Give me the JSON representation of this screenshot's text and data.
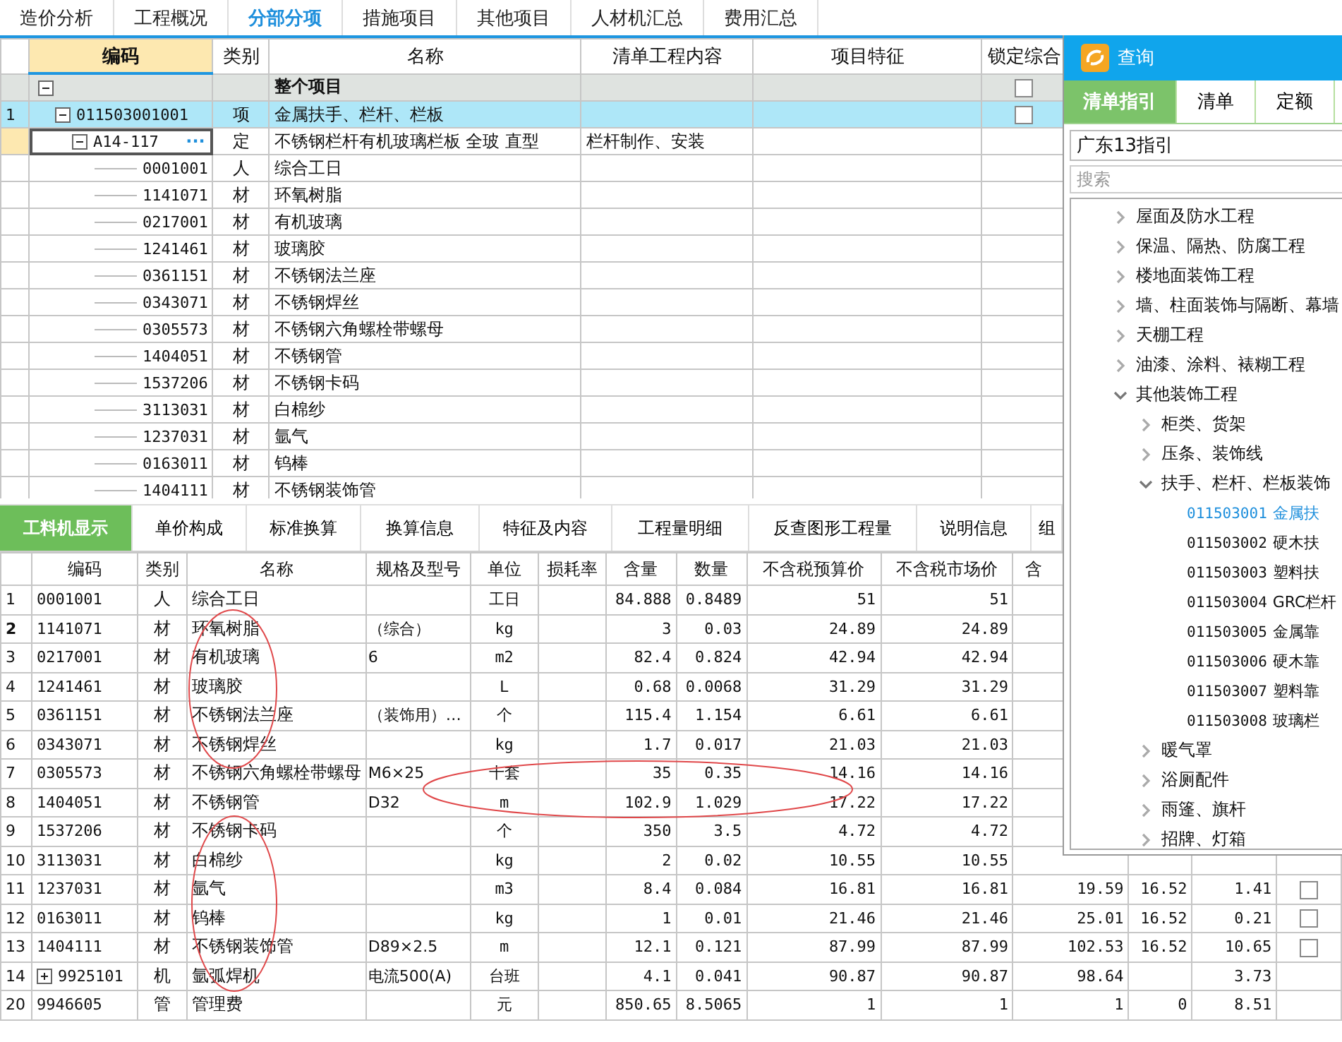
{
  "top_tabs": [
    {
      "label": "造价分析",
      "selected": false
    },
    {
      "label": "工程概况",
      "selected": false
    },
    {
      "label": "分部分项",
      "selected": true
    },
    {
      "label": "措施项目",
      "selected": false
    },
    {
      "label": "其他项目",
      "selected": false
    },
    {
      "label": "人材机汇总",
      "selected": false
    },
    {
      "label": "费用汇总",
      "selected": false
    }
  ],
  "upper_grid": {
    "columns": [
      "编码",
      "类别",
      "名称",
      "清单工程内容",
      "项目特征",
      "锁定综合"
    ],
    "tree": [
      {
        "name": "整个项目",
        "expanded": true,
        "checked": false,
        "selected": false,
        "highlighted": false,
        "children": [
          {
            "row_number": "1",
            "code": "011503001001",
            "type": "项",
            "name": "金属扶手、栏杆、栏板",
            "expanded": true,
            "checked": false,
            "selected": false,
            "highlighted": true,
            "children": [
              {
                "code": "A14-117",
                "more_button": "···",
                "type": "定",
                "name": "不锈钢栏杆有机玻璃栏板 全玻 直型",
                "content": "栏杆制作、安装",
                "expanded": true,
                "selected": true,
                "highlighted": false,
                "children": [
                  {
                    "code": "0001001",
                    "type": "人",
                    "name": "综合工日",
                    "selected": false,
                    "highlighted": false
                  },
                  {
                    "code": "1141071",
                    "type": "材",
                    "name": "环氧树脂",
                    "selected": false,
                    "highlighted": false
                  },
                  {
                    "code": "0217001",
                    "type": "材",
                    "name": "有机玻璃",
                    "selected": false,
                    "highlighted": false
                  },
                  {
                    "code": "1241461",
                    "type": "材",
                    "name": "玻璃胶",
                    "selected": false,
                    "highlighted": false
                  },
                  {
                    "code": "0361151",
                    "type": "材",
                    "name": "不锈钢法兰座",
                    "selected": false,
                    "highlighted": false
                  },
                  {
                    "code": "0343071",
                    "type": "材",
                    "name": "不锈钢焊丝",
                    "selected": false,
                    "highlighted": false
                  },
                  {
                    "code": "0305573",
                    "type": "材",
                    "name": "不锈钢六角螺栓带螺母",
                    "selected": false,
                    "highlighted": false
                  },
                  {
                    "code": "1404051",
                    "type": "材",
                    "name": "不锈钢管",
                    "selected": false,
                    "highlighted": false
                  },
                  {
                    "code": "1537206",
                    "type": "材",
                    "name": "不锈钢卡码",
                    "selected": false,
                    "highlighted": false
                  },
                  {
                    "code": "3113031",
                    "type": "材",
                    "name": "白棉纱",
                    "selected": false,
                    "highlighted": false
                  },
                  {
                    "code": "1237031",
                    "type": "材",
                    "name": "氩气",
                    "selected": false,
                    "highlighted": false
                  },
                  {
                    "code": "0163011",
                    "type": "材",
                    "name": "钨棒",
                    "selected": false,
                    "highlighted": false
                  },
                  {
                    "code": "1404111",
                    "type": "材",
                    "name": "不锈钢装饰管",
                    "selected": false,
                    "highlighted": false
                  }
                ]
              }
            ]
          }
        ]
      }
    ]
  },
  "lower_tabs": [
    {
      "label": "工料机显示",
      "selected": true
    },
    {
      "label": "单价构成",
      "selected": false
    },
    {
      "label": "标准换算",
      "selected": false
    },
    {
      "label": "换算信息",
      "selected": false
    },
    {
      "label": "特征及内容",
      "selected": false
    },
    {
      "label": "工程量明细",
      "selected": false
    },
    {
      "label": "反查图形工程量",
      "selected": false
    },
    {
      "label": "说明信息",
      "selected": false
    },
    {
      "label": "组",
      "selected": false
    }
  ],
  "lower_grid": {
    "columns": [
      "编码",
      "类别",
      "名称",
      "规格及型号",
      "单位",
      "损耗率",
      "含量",
      "数量",
      "不含税预算价",
      "不含税市场价",
      "含"
    ],
    "rows": [
      {
        "row_number": "1",
        "code": "0001001",
        "type": "人",
        "name": "综合工日",
        "unit": "工日",
        "amount": "84.888",
        "quantity": "0.8489",
        "budget_price": "51",
        "market_price": "51",
        "selected": false,
        "expandable": false
      },
      {
        "row_number": "2",
        "code": "1141071",
        "type": "材",
        "name": "环氧树脂",
        "spec": "（综合）",
        "unit": "kg",
        "amount": "3",
        "quantity": "0.03",
        "budget_price": "24.89",
        "market_price": "24.89",
        "selected": true,
        "expandable": false
      },
      {
        "row_number": "3",
        "code": "0217001",
        "type": "材",
        "name": "有机玻璃",
        "spec": "6",
        "unit": "m2",
        "amount": "82.4",
        "quantity": "0.824",
        "budget_price": "42.94",
        "market_price": "42.94",
        "selected": false,
        "expandable": false
      },
      {
        "row_number": "4",
        "code": "1241461",
        "type": "材",
        "name": "玻璃胶",
        "unit": "L",
        "amount": "0.68",
        "quantity": "0.0068",
        "budget_price": "31.29",
        "market_price": "31.29",
        "selected": false,
        "expandable": false
      },
      {
        "row_number": "5",
        "code": "0361151",
        "type": "材",
        "name": "不锈钢法兰座",
        "spec": "（装饰用）…",
        "unit": "个",
        "amount": "115.4",
        "quantity": "1.154",
        "budget_price": "6.61",
        "market_price": "6.61",
        "selected": false,
        "expandable": false
      },
      {
        "row_number": "6",
        "code": "0343071",
        "type": "材",
        "name": "不锈钢焊丝",
        "unit": "kg",
        "amount": "1.7",
        "quantity": "0.017",
        "budget_price": "21.03",
        "market_price": "21.03",
        "selected": false,
        "expandable": false
      },
      {
        "row_number": "7",
        "code": "0305573",
        "type": "材",
        "name": "不锈钢六角螺栓带螺母",
        "spec": "M6×25",
        "unit": "十套",
        "amount": "35",
        "quantity": "0.35",
        "budget_price": "14.16",
        "market_price": "14.16",
        "selected": false,
        "expandable": false
      },
      {
        "row_number": "8",
        "code": "1404051",
        "type": "材",
        "name": "不锈钢管",
        "spec": "D32",
        "unit": "m",
        "amount": "102.9",
        "quantity": "1.029",
        "budget_price": "17.22",
        "market_price": "17.22",
        "selected": false,
        "expandable": false
      },
      {
        "row_number": "9",
        "code": "1537206",
        "type": "材",
        "name": "不锈钢卡码",
        "unit": "个",
        "amount": "350",
        "quantity": "3.5",
        "budget_price": "4.72",
        "market_price": "4.72",
        "selected": false,
        "expandable": false
      },
      {
        "row_number": "10",
        "code": "3113031",
        "type": "材",
        "name": "白棉纱",
        "unit": "kg",
        "amount": "2",
        "quantity": "0.02",
        "budget_price": "10.55",
        "market_price": "10.55",
        "selected": false,
        "expandable": false
      },
      {
        "row_number": "11",
        "code": "1237031",
        "type": "材",
        "name": "氩气",
        "unit": "m3",
        "amount": "8.4",
        "quantity": "0.084",
        "budget_price": "16.81",
        "market_price": "16.81",
        "column_11": "19.59",
        "column_12": "16.52",
        "column_13": "1.41",
        "selected": false,
        "expandable": false,
        "checked": false
      },
      {
        "row_number": "12",
        "code": "0163011",
        "type": "材",
        "name": "钨棒",
        "unit": "kg",
        "amount": "1",
        "quantity": "0.01",
        "budget_price": "21.46",
        "market_price": "21.46",
        "column_11": "25.01",
        "column_12": "16.52",
        "column_13": "0.21",
        "selected": false,
        "expandable": false,
        "checked": false
      },
      {
        "row_number": "13",
        "code": "1404111",
        "type": "材",
        "name": "不锈钢装饰管",
        "spec": "D89×2.5",
        "unit": "m",
        "amount": "12.1",
        "quantity": "0.121",
        "budget_price": "87.99",
        "market_price": "87.99",
        "column_11": "102.53",
        "column_12": "16.52",
        "column_13": "10.65",
        "selected": false,
        "expandable": false,
        "checked": false
      },
      {
        "row_number": "14",
        "code": "9925101",
        "type": "机",
        "name": "氩弧焊机",
        "spec": "电流500(A)",
        "unit": "台班",
        "amount": "4.1",
        "quantity": "0.041",
        "budget_price": "90.87",
        "market_price": "90.87",
        "column_11": "98.64",
        "column_13": "3.73",
        "selected": false,
        "expandable": true
      },
      {
        "row_number": "20",
        "code": "9946605",
        "type": "管",
        "name": "管理费",
        "unit": "元",
        "amount": "850.65",
        "quantity": "8.5065",
        "budget_price": "1",
        "market_price": "1",
        "column_11": "1",
        "column_12": "0",
        "column_13": "8.51",
        "selected": false,
        "expandable": false
      }
    ]
  },
  "query_panel": {
    "title": "查询",
    "tabs": [
      {
        "label": "清单指引",
        "selected": true
      },
      {
        "label": "清单",
        "selected": false
      },
      {
        "label": "定额",
        "selected": false
      }
    ],
    "guide": "广东13指引",
    "search_placeholder": "搜索",
    "tree": [
      {
        "label": "屋面及防水工程",
        "expanded": false
      },
      {
        "label": "保温、隔热、防腐工程",
        "expanded": false
      },
      {
        "label": "楼地面装饰工程",
        "expanded": false
      },
      {
        "label": "墙、柱面装饰与隔断、幕墙",
        "expanded": false
      },
      {
        "label": "天棚工程",
        "expanded": false
      },
      {
        "label": "油漆、涂料、裱糊工程",
        "expanded": false
      },
      {
        "label": "其他装饰工程",
        "expanded": true,
        "children": [
          {
            "label": "柜类、货架",
            "expanded": false
          },
          {
            "label": "压条、装饰线",
            "expanded": false
          },
          {
            "label": "扶手、栏杆、栏板装饰",
            "expanded": true,
            "children": [
              {
                "code": "011503001",
                "name": "金属扶",
                "selected": true
              },
              {
                "code": "011503002",
                "name": "硬木扶",
                "selected": false
              },
              {
                "code": "011503003",
                "name": "塑料扶",
                "selected": false
              },
              {
                "code": "011503004",
                "name": "GRC栏杆",
                "selected": false
              },
              {
                "code": "011503005",
                "name": "金属靠",
                "selected": false
              },
              {
                "code": "011503006",
                "name": "硬木靠",
                "selected": false
              },
              {
                "code": "011503007",
                "name": "塑料靠",
                "selected": false
              },
              {
                "code": "011503008",
                "name": "玻璃栏",
                "selected": false
              }
            ]
          },
          {
            "label": "暖气罩",
            "expanded": false
          },
          {
            "label": "浴厕配件",
            "expanded": false
          },
          {
            "label": "雨篷、旗杆",
            "expanded": false
          },
          {
            "label": "招牌、灯箱",
            "expanded": false
          }
        ]
      }
    ]
  }
}
